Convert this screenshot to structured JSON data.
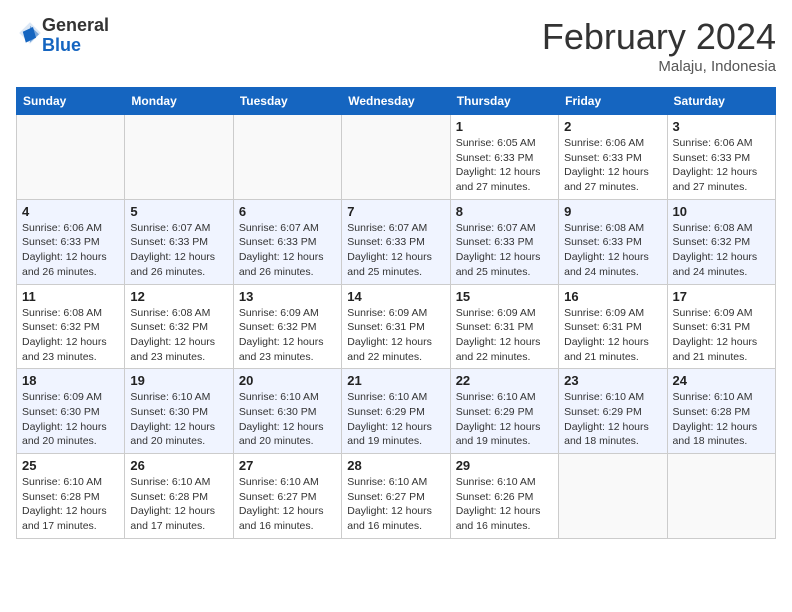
{
  "header": {
    "logo_general": "General",
    "logo_blue": "Blue",
    "month_title": "February 2024",
    "subtitle": "Malaju, Indonesia"
  },
  "days_of_week": [
    "Sunday",
    "Monday",
    "Tuesday",
    "Wednesday",
    "Thursday",
    "Friday",
    "Saturday"
  ],
  "weeks": [
    {
      "stripe": false,
      "days": [
        {
          "number": "",
          "info": ""
        },
        {
          "number": "",
          "info": ""
        },
        {
          "number": "",
          "info": ""
        },
        {
          "number": "",
          "info": ""
        },
        {
          "number": "1",
          "info": "Sunrise: 6:05 AM\nSunset: 6:33 PM\nDaylight: 12 hours and 27 minutes."
        },
        {
          "number": "2",
          "info": "Sunrise: 6:06 AM\nSunset: 6:33 PM\nDaylight: 12 hours and 27 minutes."
        },
        {
          "number": "3",
          "info": "Sunrise: 6:06 AM\nSunset: 6:33 PM\nDaylight: 12 hours and 27 minutes."
        }
      ]
    },
    {
      "stripe": true,
      "days": [
        {
          "number": "4",
          "info": "Sunrise: 6:06 AM\nSunset: 6:33 PM\nDaylight: 12 hours and 26 minutes."
        },
        {
          "number": "5",
          "info": "Sunrise: 6:07 AM\nSunset: 6:33 PM\nDaylight: 12 hours and 26 minutes."
        },
        {
          "number": "6",
          "info": "Sunrise: 6:07 AM\nSunset: 6:33 PM\nDaylight: 12 hours and 26 minutes."
        },
        {
          "number": "7",
          "info": "Sunrise: 6:07 AM\nSunset: 6:33 PM\nDaylight: 12 hours and 25 minutes."
        },
        {
          "number": "8",
          "info": "Sunrise: 6:07 AM\nSunset: 6:33 PM\nDaylight: 12 hours and 25 minutes."
        },
        {
          "number": "9",
          "info": "Sunrise: 6:08 AM\nSunset: 6:33 PM\nDaylight: 12 hours and 24 minutes."
        },
        {
          "number": "10",
          "info": "Sunrise: 6:08 AM\nSunset: 6:32 PM\nDaylight: 12 hours and 24 minutes."
        }
      ]
    },
    {
      "stripe": false,
      "days": [
        {
          "number": "11",
          "info": "Sunrise: 6:08 AM\nSunset: 6:32 PM\nDaylight: 12 hours and 23 minutes."
        },
        {
          "number": "12",
          "info": "Sunrise: 6:08 AM\nSunset: 6:32 PM\nDaylight: 12 hours and 23 minutes."
        },
        {
          "number": "13",
          "info": "Sunrise: 6:09 AM\nSunset: 6:32 PM\nDaylight: 12 hours and 23 minutes."
        },
        {
          "number": "14",
          "info": "Sunrise: 6:09 AM\nSunset: 6:31 PM\nDaylight: 12 hours and 22 minutes."
        },
        {
          "number": "15",
          "info": "Sunrise: 6:09 AM\nSunset: 6:31 PM\nDaylight: 12 hours and 22 minutes."
        },
        {
          "number": "16",
          "info": "Sunrise: 6:09 AM\nSunset: 6:31 PM\nDaylight: 12 hours and 21 minutes."
        },
        {
          "number": "17",
          "info": "Sunrise: 6:09 AM\nSunset: 6:31 PM\nDaylight: 12 hours and 21 minutes."
        }
      ]
    },
    {
      "stripe": true,
      "days": [
        {
          "number": "18",
          "info": "Sunrise: 6:09 AM\nSunset: 6:30 PM\nDaylight: 12 hours and 20 minutes."
        },
        {
          "number": "19",
          "info": "Sunrise: 6:10 AM\nSunset: 6:30 PM\nDaylight: 12 hours and 20 minutes."
        },
        {
          "number": "20",
          "info": "Sunrise: 6:10 AM\nSunset: 6:30 PM\nDaylight: 12 hours and 20 minutes."
        },
        {
          "number": "21",
          "info": "Sunrise: 6:10 AM\nSunset: 6:29 PM\nDaylight: 12 hours and 19 minutes."
        },
        {
          "number": "22",
          "info": "Sunrise: 6:10 AM\nSunset: 6:29 PM\nDaylight: 12 hours and 19 minutes."
        },
        {
          "number": "23",
          "info": "Sunrise: 6:10 AM\nSunset: 6:29 PM\nDaylight: 12 hours and 18 minutes."
        },
        {
          "number": "24",
          "info": "Sunrise: 6:10 AM\nSunset: 6:28 PM\nDaylight: 12 hours and 18 minutes."
        }
      ]
    },
    {
      "stripe": false,
      "days": [
        {
          "number": "25",
          "info": "Sunrise: 6:10 AM\nSunset: 6:28 PM\nDaylight: 12 hours and 17 minutes."
        },
        {
          "number": "26",
          "info": "Sunrise: 6:10 AM\nSunset: 6:28 PM\nDaylight: 12 hours and 17 minutes."
        },
        {
          "number": "27",
          "info": "Sunrise: 6:10 AM\nSunset: 6:27 PM\nDaylight: 12 hours and 16 minutes."
        },
        {
          "number": "28",
          "info": "Sunrise: 6:10 AM\nSunset: 6:27 PM\nDaylight: 12 hours and 16 minutes."
        },
        {
          "number": "29",
          "info": "Sunrise: 6:10 AM\nSunset: 6:26 PM\nDaylight: 12 hours and 16 minutes."
        },
        {
          "number": "",
          "info": ""
        },
        {
          "number": "",
          "info": ""
        }
      ]
    }
  ]
}
